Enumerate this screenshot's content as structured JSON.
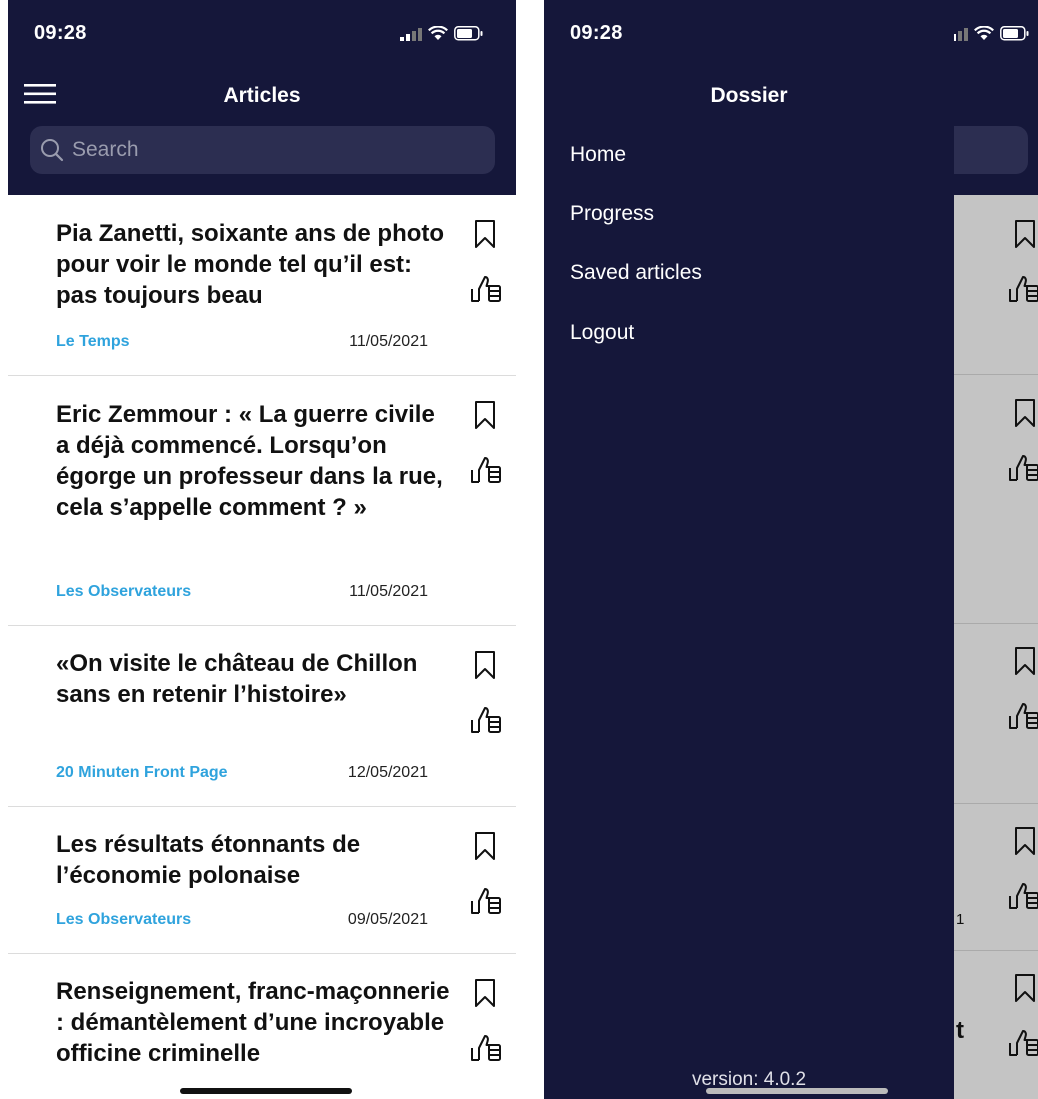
{
  "status": {
    "time": "09:28"
  },
  "left_screen": {
    "title": "Articles",
    "search_placeholder": "Search",
    "articles": [
      {
        "title": "Pia Zanetti, soixante ans de photo pour voir le monde tel qu’il est: pas toujours beau",
        "source": "Le Temps",
        "date": "11/05/2021"
      },
      {
        "title": "Eric Zemmour : « La guerre civile a déjà commencé. Lorsqu’on égorge un professeur dans la rue, cela s’appelle comment ? »",
        "source": "Les Observateurs",
        "date": "11/05/2021"
      },
      {
        "title": "«On visite le château de Chillon sans en retenir l’histoire»",
        "source": "20 Minuten Front Page",
        "date": "12/05/2021"
      },
      {
        "title": "Les résultats étonnants de l’économie polonaise",
        "source": "Les Observateurs",
        "date": "09/05/2021"
      },
      {
        "title": "Renseignement, franc-maçonnerie : démantèlement d’une incroyable officine criminelle",
        "source": "",
        "date": ""
      }
    ]
  },
  "right_screen": {
    "drawer_title": "Dossier",
    "menu": [
      {
        "label": "Home"
      },
      {
        "label": "Progress"
      },
      {
        "label": "Saved articles"
      },
      {
        "label": "Logout"
      }
    ],
    "version": "version: 4.0.2",
    "partial_date_fragment": "1",
    "partial_title_fragment": "t"
  },
  "icons": {
    "menu": "hamburger-icon",
    "search": "search-icon",
    "bookmark": "bookmark-icon",
    "like": "thumbs-up-icon",
    "signal": "signal-icon",
    "wifi": "wifi-icon",
    "battery": "battery-icon"
  },
  "colors": {
    "navbar": "#15173a",
    "search_bg": "#2c2e51",
    "source_link": "#2fa3dd",
    "dim_overlay": "#c4c4c4"
  }
}
